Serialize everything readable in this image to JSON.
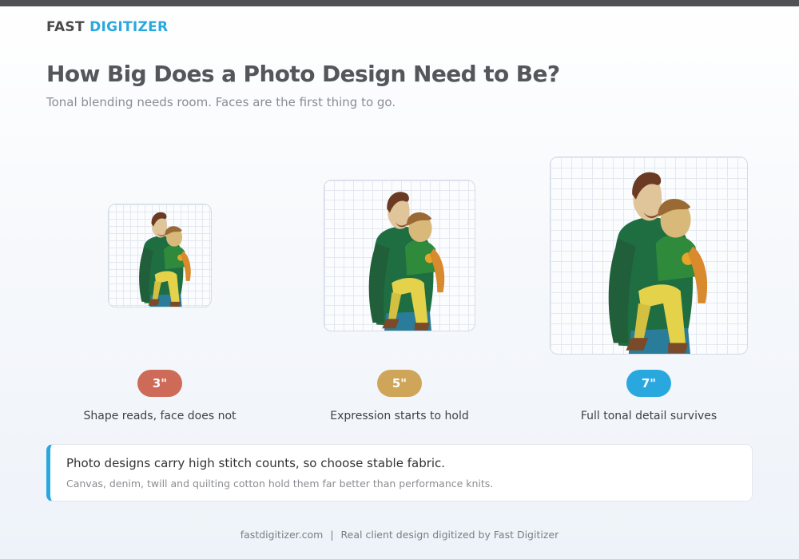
{
  "brand": {
    "part1": "FAST",
    "part2": "DIGITIZER",
    "color_dark": "#4a4a4a",
    "color_accent": "#29a8e0"
  },
  "header": {
    "title": "How Big Does a Photo Design Need to Be?",
    "subtitle": "Tonal blending needs room. Faces are the first thing to go."
  },
  "sizes": [
    {
      "label": "3\"",
      "caption": "Shape reads, face does not",
      "color": "#cd6b58"
    },
    {
      "label": "5\"",
      "caption": "Expression starts to hold",
      "color": "#cfa55a"
    },
    {
      "label": "7\"",
      "caption": "Full tonal detail survives",
      "color": "#29a8e0"
    }
  ],
  "note": {
    "title": "Photo designs carry high stitch counts, so choose stable fabric.",
    "body": "Canvas, denim, twill and quilting cotton hold them far better than performance knits.",
    "accent": "#29a8e0"
  },
  "footer": {
    "site": "fastdigitizer.com",
    "separator": "|",
    "credit": "Real client design digitized by Fast Digitizer"
  }
}
